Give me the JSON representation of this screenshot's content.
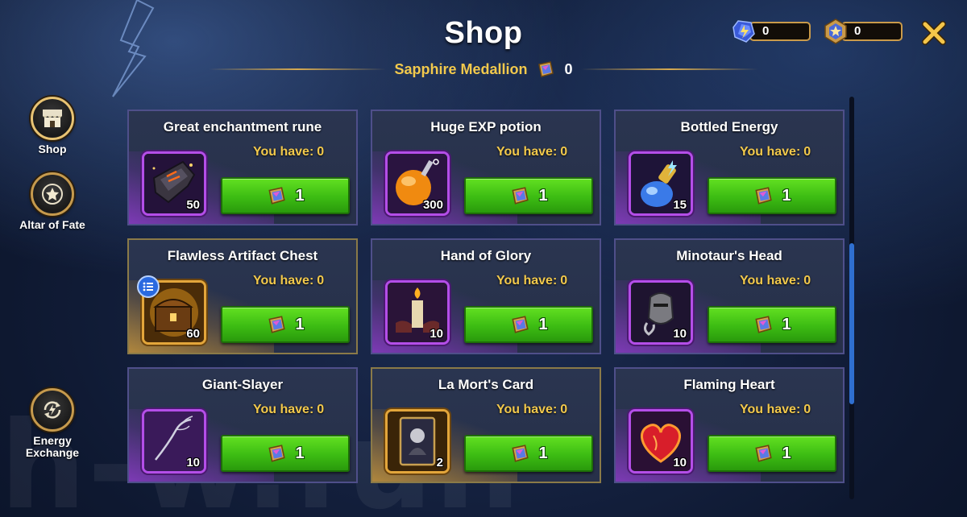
{
  "header": {
    "title": "Shop",
    "subtitle": "Sapphire Medallion",
    "subtitle_count": "0"
  },
  "currencies": {
    "energy": {
      "icon": "energy-crystal-icon",
      "value": "0"
    },
    "medallion": {
      "icon": "medallion-icon",
      "value": "0"
    }
  },
  "nav": {
    "items": [
      {
        "label": "Shop",
        "icon": "shop-icon",
        "active": true
      },
      {
        "label": "Altar of Fate",
        "icon": "star-icon",
        "active": false
      },
      {
        "label": "Energy Exchange",
        "icon": "energy-exchange-icon",
        "active": false
      }
    ]
  },
  "shop": {
    "have_label": "You have:",
    "items": [
      {
        "name": "Great enchantment rune",
        "have": "0",
        "qty": "50",
        "price": "1",
        "rarity": "purple"
      },
      {
        "name": "Huge EXP potion",
        "have": "0",
        "qty": "300",
        "price": "1",
        "rarity": "purple"
      },
      {
        "name": "Bottled Energy",
        "have": "0",
        "qty": "15",
        "price": "1",
        "rarity": "purple"
      },
      {
        "name": "Flawless Artifact Chest",
        "have": "0",
        "qty": "60",
        "price": "1",
        "rarity": "gold"
      },
      {
        "name": "Hand of Glory",
        "have": "0",
        "qty": "10",
        "price": "1",
        "rarity": "purple"
      },
      {
        "name": "Minotaur's Head",
        "have": "0",
        "qty": "10",
        "price": "1",
        "rarity": "purple"
      },
      {
        "name": "Giant-Slayer",
        "have": "0",
        "qty": "10",
        "price": "1",
        "rarity": "purple"
      },
      {
        "name": "La Mort's Card",
        "have": "0",
        "qty": "2",
        "price": "1",
        "rarity": "gold"
      },
      {
        "name": "Flaming Heart",
        "have": "0",
        "qty": "10",
        "price": "1",
        "rarity": "purple"
      }
    ]
  },
  "watermark": "h-w.fun",
  "colors": {
    "gold_text": "#f2c94c",
    "button_green": "#3cbc13",
    "purple_rarity": "#b44ee8",
    "gold_rarity": "#e3a63b",
    "scroll_thumb": "#2f6fd0"
  }
}
